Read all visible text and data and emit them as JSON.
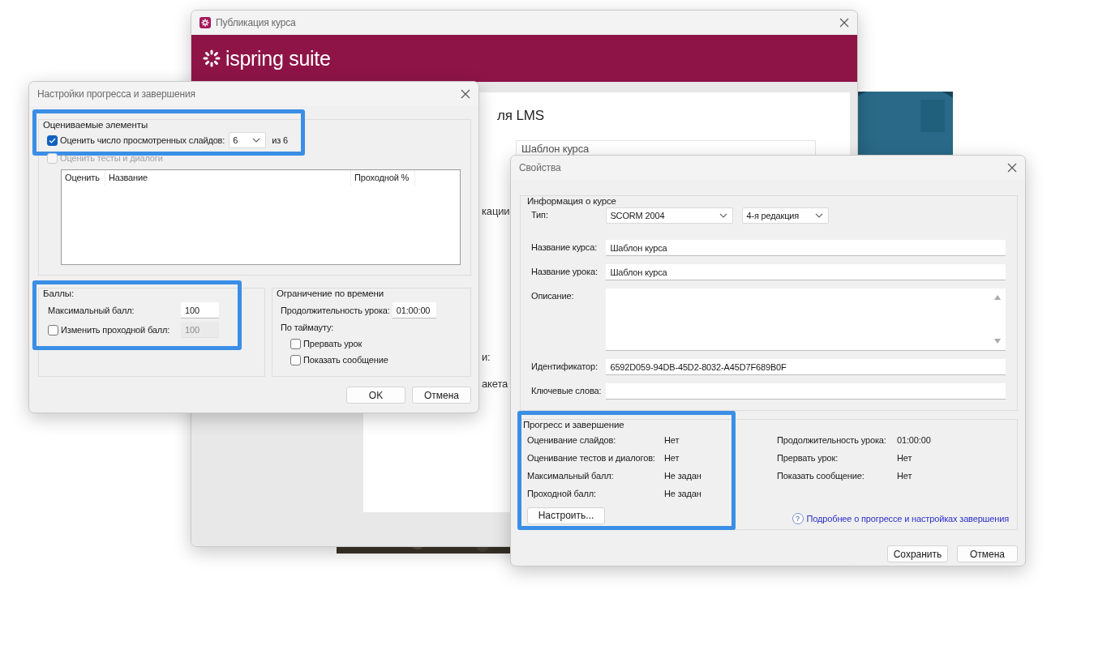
{
  "background_window": {
    "title": "Публикация курса",
    "logo": "ispring suite",
    "fragments": [
      {
        "kind": "heading",
        "text": "ля LMS"
      },
      {
        "kind": "field",
        "text": "Шаблон курса"
      },
      {
        "kind": "label",
        "text": "кации"
      },
      {
        "kind": "label",
        "text": "и:"
      },
      {
        "kind": "label",
        "text": "акета"
      }
    ]
  },
  "progress_dialog": {
    "title": "Настройки прогресса и завершения",
    "graded_items": {
      "title": "Оцениваемые элементы",
      "highlighted": true,
      "slides": {
        "label": "Оценить число просмотренных слайдов:",
        "checked": true,
        "count": "6",
        "of": "из 6"
      },
      "quizzes": {
        "label": "Оценить тесты и диалоги",
        "checked": false,
        "disabled": true
      },
      "table": {
        "columns": [
          "Оценить",
          "Название",
          "Проходной %"
        ]
      }
    },
    "score": {
      "title": "Баллы:",
      "highlighted": true,
      "max_label": "Максимальный балл:",
      "max_value": "100",
      "passing": {
        "label": "Изменить проходной балл:",
        "checked": false,
        "value": "100",
        "disabled": true
      }
    },
    "time_limit": {
      "title": "Ограничение по времени",
      "duration_label": "Продолжительность урока:",
      "duration": "01:00:00",
      "timeout_label": "По таймауту:",
      "options": [
        {
          "label": "Прервать урок",
          "checked": false
        },
        {
          "label": "Показать сообщение",
          "checked": false
        }
      ]
    },
    "buttons": [
      "OK",
      "Отмена"
    ]
  },
  "properties_dialog": {
    "title": "Свойства",
    "course_info": {
      "title": "Информация о курсе",
      "type_label": "Тип:",
      "type": "SCORM 2004",
      "edition": "4-я редакция",
      "fields": [
        {
          "kind": "line",
          "label": "Название курса:",
          "value": "Шаблон курса"
        },
        {
          "kind": "line",
          "label": "Название урока:",
          "value": "Шаблон курса"
        },
        {
          "kind": "multiline",
          "label": "Описание:"
        },
        {
          "kind": "line",
          "label": "Идентификатор:",
          "value": "6592D059-94DB-45D2-8032-A45D7F689B0F"
        },
        {
          "kind": "line",
          "label": "Ключевые слова:"
        }
      ]
    },
    "progress": {
      "title": "Прогресс и завершение",
      "highlighted": true,
      "left": [
        {
          "label": "Оценивание слайдов:",
          "value": "Нет"
        },
        {
          "label": "Оценивание тестов и диалогов:",
          "value": "Нет"
        },
        {
          "label": "Максимальный балл:",
          "value": "Не задан"
        },
        {
          "label": "Проходной балл:",
          "value": "Не задан"
        }
      ],
      "right": [
        {
          "label": "Продолжительность урока:",
          "value": "01:00:00"
        },
        {
          "label": "Прервать урок:",
          "value": "Нет"
        },
        {
          "label": "Показать сообщение:",
          "value": "Нет"
        }
      ],
      "configure": "Настроить...",
      "help_icon": "?",
      "help_link": "Подробнее о прогрессе и настройках завершения"
    },
    "buttons": [
      "Сохранить",
      "Отмена"
    ]
  }
}
